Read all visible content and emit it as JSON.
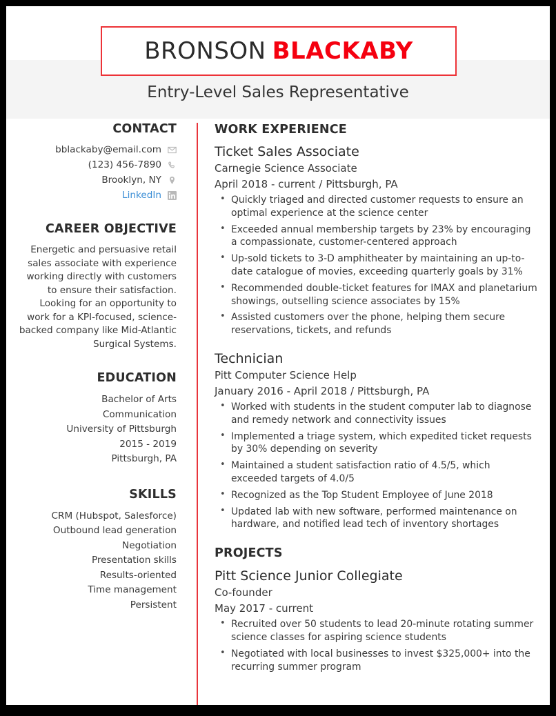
{
  "header": {
    "name_first": "BRONSON",
    "name_last": "BLACKABY",
    "job_title": "Entry-Level Sales Representative"
  },
  "sidebar": {
    "contact": {
      "heading": "CONTACT",
      "items": [
        {
          "text": "bblackaby@email.com",
          "icon": "envelope-icon",
          "is_link": false
        },
        {
          "text": "(123) 456-7890",
          "icon": "phone-icon",
          "is_link": false
        },
        {
          "text": "Brooklyn, NY",
          "icon": "location-pin-icon",
          "is_link": false
        },
        {
          "text": "LinkedIn",
          "icon": "linkedin-icon",
          "is_link": true
        }
      ]
    },
    "objective": {
      "heading": "CAREER OBJECTIVE",
      "text": "Energetic and persuasive retail sales associate with experience working directly with customers to ensure their satisfaction. Looking for an opportunity to work for a KPI-focused, science-backed company like Mid-Atlantic Surgical Systems."
    },
    "education": {
      "heading": "EDUCATION",
      "lines": [
        "Bachelor of Arts",
        "Communication",
        "University of Pittsburgh",
        "2015 - 2019",
        "Pittsburgh, PA"
      ]
    },
    "skills": {
      "heading": "SKILLS",
      "items": [
        "CRM (Hubspot, Salesforce)",
        "Outbound lead generation",
        "Negotiation",
        "Presentation skills",
        "Results-oriented",
        "Time management",
        "Persistent"
      ]
    }
  },
  "main": {
    "work": {
      "heading": "WORK EXPERIENCE",
      "entries": [
        {
          "title": "Ticket Sales Associate",
          "org": "Carnegie Science Associate",
          "dates": "April 2018 - current",
          "separator": "/",
          "location": "Pittsburgh, PA",
          "bullets": [
            "Quickly triaged and directed customer requests to ensure an optimal experience at the science center",
            "Exceeded annual membership targets by 23% by encouraging a compassionate, customer-centered approach",
            "Up-sold tickets to 3-D amphitheater by maintaining an up-to-date catalogue of movies, exceeding quarterly goals by 31%",
            "Recommended double-ticket features for IMAX and planetarium showings, outselling science associates by 15%",
            "Assisted customers over the phone, helping them secure reservations, tickets, and refunds"
          ]
        },
        {
          "title": "Technician",
          "org": "Pitt Computer Science Help",
          "dates": "January 2016 - April 2018",
          "separator": "/",
          "location": "Pittsburgh, PA",
          "bullets": [
            "Worked with students in the student computer lab to diagnose and remedy network and connectivity issues",
            "Implemented a triage system, which expedited ticket requests by 30% depending on severity",
            "Maintained a student satisfaction ratio of 4.5/5, which exceeded targets of 4.0/5",
            "Recognized as the Top Student Employee of June 2018",
            "Updated lab with new software, performed maintenance on hardware, and notified lead tech of inventory shortages"
          ]
        }
      ]
    },
    "projects": {
      "heading": "PROJECTS",
      "entries": [
        {
          "title": "Pitt Science Junior Collegiate",
          "org": "Co-founder",
          "dates": "May 2017 - current",
          "separator": "",
          "location": "",
          "bullets": [
            "Recruited over 50 students to lead 20-minute rotating summer science classes for aspiring science students",
            "Negotiated with local businesses to invest $325,000+ into the recurring summer program"
          ]
        }
      ]
    }
  },
  "colors": {
    "accent_red": "#ed3237",
    "name_red": "#f5000f",
    "heading_dark": "#2d2d2d",
    "link_blue": "#3d8fd6",
    "band_gray": "#f4f4f4",
    "frame_black": "#000000"
  }
}
